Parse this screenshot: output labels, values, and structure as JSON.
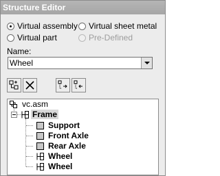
{
  "window": {
    "title": "Structure Editor"
  },
  "options": {
    "virtual_assembly": "Virtual assembly",
    "virtual_sheet_metal": "Virtual sheet metal",
    "virtual_part": "Virtual part",
    "pre_defined": "Pre-Defined",
    "selected": "virtual_assembly"
  },
  "name": {
    "label": "Name:",
    "value": "Wheel"
  },
  "toolbar": {
    "icons": [
      "new-component-icon",
      "delete-icon",
      "demote-icon",
      "promote-icon"
    ]
  },
  "tree": {
    "root": "vc.asm",
    "frame": "Frame",
    "support": "Support",
    "front_axle": "Front Axle",
    "rear_axle": "Rear Axle",
    "wheel_1": "Wheel",
    "wheel_2": "Wheel"
  },
  "colors": {
    "titlebar": "#aaaaaa",
    "window_bg": "#ececec",
    "selection": "#d9d9d9"
  }
}
